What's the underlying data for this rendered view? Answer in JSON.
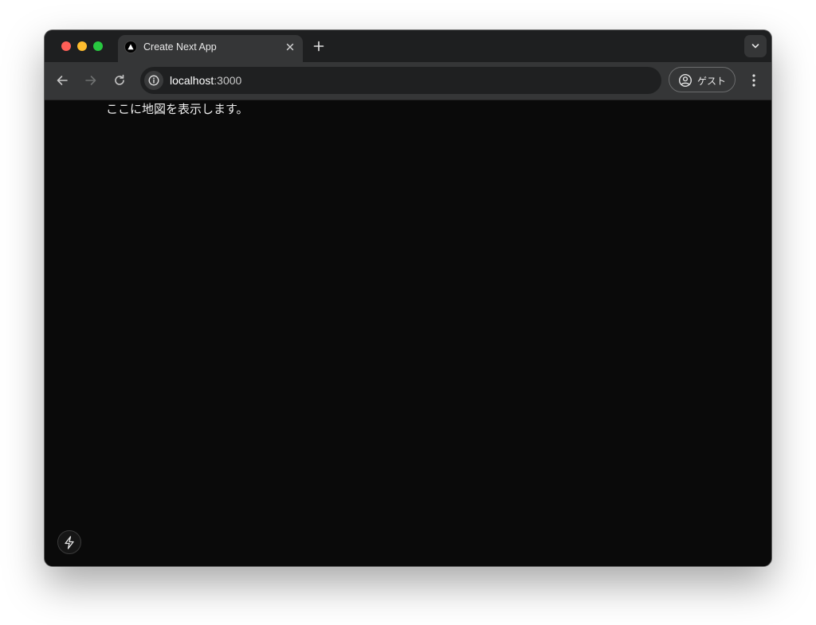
{
  "browser": {
    "tab": {
      "title": "Create Next App",
      "favicon": "nextjs-triangle-icon"
    },
    "address_bar": {
      "host": "localhost",
      "port": ":3000",
      "site_info_icon": "info-icon"
    },
    "profile": {
      "label": "ゲスト",
      "icon": "person-circle-icon"
    },
    "colors": {
      "tab_bar": "#1e1f20",
      "toolbar": "#353637",
      "omnibox": "#1f2021",
      "page_background": "#0a0a0a",
      "traffic_close": "#fe5f57",
      "traffic_minimize": "#febc2e",
      "traffic_maximize": "#28c840"
    }
  },
  "page": {
    "map_placeholder_text": "ここに地図を表示します。",
    "dev_indicator_icon": "lightning-bolt-icon"
  }
}
